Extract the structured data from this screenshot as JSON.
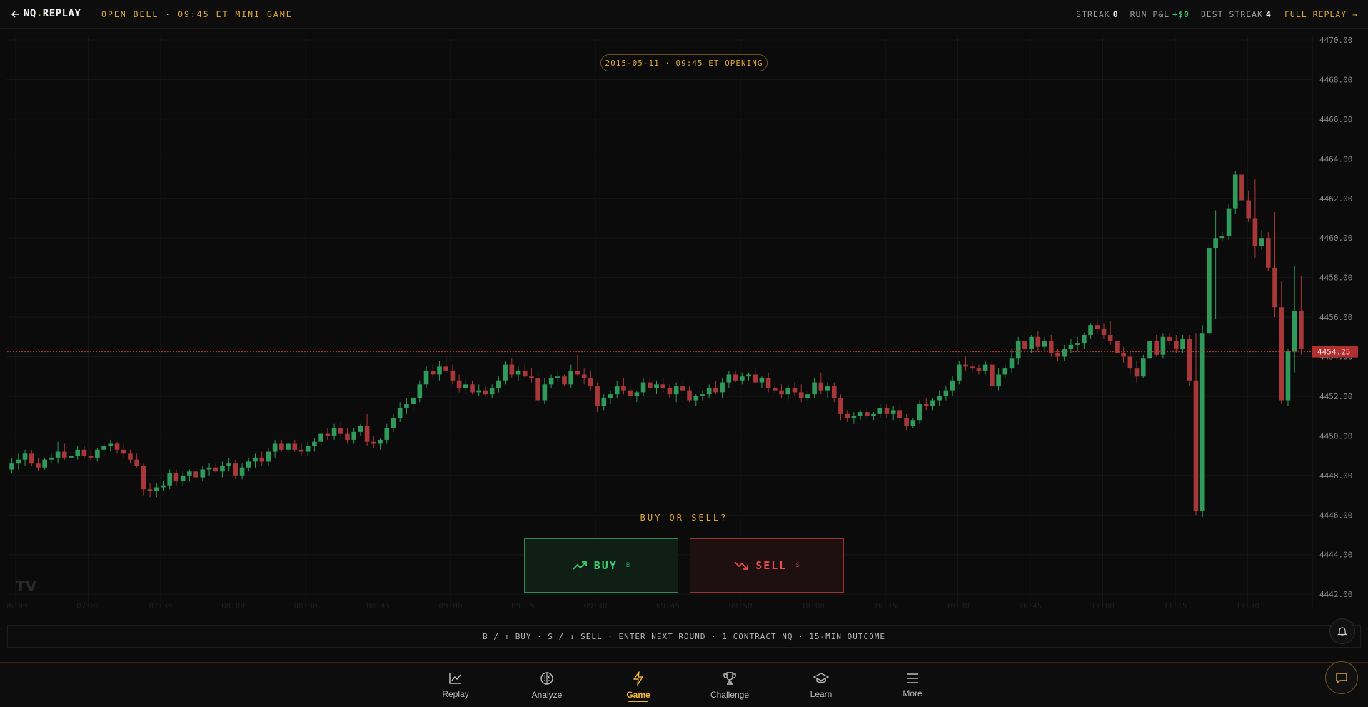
{
  "header": {
    "brand_left": "NQ",
    "brand_dot": ".",
    "brand_right": "REPLAY",
    "subtitle": "OPEN BELL · 09:45 ET MINI GAME",
    "streak_label": "STREAK",
    "streak_value": "0",
    "pnl_label": "RUN P&L",
    "pnl_value": "+$0",
    "best_label": "BEST STREAK",
    "best_value": "4",
    "full_replay": "FULL REPLAY →"
  },
  "session_pill": "2015-05-11 · 09:45 ET OPENING",
  "prompt": "BUY OR SELL?",
  "buy": {
    "label": "BUY",
    "key": "B"
  },
  "sell": {
    "label": "SELL",
    "key": "S"
  },
  "hint": "B / ↑ BUY · S / ↓ SELL · ENTER NEXT ROUND · 1 CONTRACT NQ · 15-MIN OUTCOME",
  "colors": {
    "accent": "#e0a53c",
    "up": "#2f9a5a",
    "down": "#a83838",
    "price_line": "#c0392b"
  },
  "chart_data": {
    "type": "candlestick",
    "y_ticks": [
      "4470.00",
      "4468.00",
      "4466.00",
      "4464.00",
      "4462.00",
      "4460.00",
      "4458.00",
      "4456.00",
      "4454.00",
      "4452.00",
      "4450.00",
      "4448.00",
      "4446.00",
      "4444.00",
      "4442.00"
    ],
    "ylim": [
      4441.5,
      4470.0
    ],
    "last_price": "4454.25",
    "x_ticks": [
      "06:00",
      "07:00",
      "07:30",
      "08:00",
      "08:30",
      "08:45",
      "09:00",
      "09:15",
      "09:30",
      "09:45",
      "09:50",
      "10:00",
      "10:15",
      "10:30",
      "10:45",
      "11:00",
      "11:15",
      "11:30"
    ],
    "ohlc": [
      [
        4448.3,
        4448.9,
        4448.1,
        4448.6
      ],
      [
        4448.6,
        4449.1,
        4448.3,
        4448.8
      ],
      [
        4448.8,
        4449.3,
        4448.5,
        4449.1
      ],
      [
        4449.1,
        4449.3,
        4448.5,
        4448.6
      ],
      [
        4448.6,
        4448.9,
        4448.2,
        4448.4
      ],
      [
        4448.4,
        4448.9,
        4448.3,
        4448.8
      ],
      [
        4448.8,
        4449.1,
        4448.6,
        4448.9
      ],
      [
        4448.9,
        4449.7,
        4448.6,
        4449.2
      ],
      [
        4449.2,
        4449.6,
        4448.8,
        4448.9
      ],
      [
        4448.9,
        4449.2,
        4448.7,
        4449.0
      ],
      [
        4449.0,
        4449.5,
        4448.8,
        4449.3
      ],
      [
        4449.3,
        4449.5,
        4448.9,
        4449.0
      ],
      [
        4449.0,
        4449.3,
        4448.7,
        4448.9
      ],
      [
        4448.9,
        4449.4,
        4448.7,
        4449.3
      ],
      [
        4449.3,
        4449.7,
        4449.0,
        4449.5
      ],
      [
        4449.5,
        4449.8,
        4449.2,
        4449.6
      ],
      [
        4449.6,
        4449.7,
        4449.1,
        4449.3
      ],
      [
        4449.3,
        4449.6,
        4448.9,
        4449.1
      ],
      [
        4449.1,
        4449.3,
        4448.6,
        4448.8
      ],
      [
        4448.8,
        4449.1,
        4448.4,
        4448.5
      ],
      [
        4448.5,
        4448.6,
        4447.0,
        4447.3
      ],
      [
        4447.3,
        4447.6,
        4446.9,
        4447.2
      ],
      [
        4447.2,
        4447.6,
        4446.9,
        4447.4
      ],
      [
        4447.4,
        4447.7,
        4447.2,
        4447.5
      ],
      [
        4447.5,
        4448.3,
        4447.3,
        4448.1
      ],
      [
        4448.1,
        4448.3,
        4447.5,
        4447.7
      ],
      [
        4447.7,
        4448.2,
        4447.5,
        4448.0
      ],
      [
        4448.0,
        4448.3,
        4447.7,
        4448.2
      ],
      [
        4448.2,
        4448.4,
        4447.7,
        4447.9
      ],
      [
        4447.9,
        4448.5,
        4447.7,
        4448.3
      ],
      [
        4448.3,
        4448.6,
        4448.0,
        4448.4
      ],
      [
        4448.4,
        4448.6,
        4448.1,
        4448.2
      ],
      [
        4448.2,
        4448.7,
        4447.9,
        4448.5
      ],
      [
        4448.5,
        4448.9,
        4448.2,
        4448.6
      ],
      [
        4448.6,
        4448.8,
        4447.8,
        4448.0
      ],
      [
        4448.0,
        4448.6,
        4447.8,
        4448.4
      ],
      [
        4448.4,
        4448.9,
        4448.2,
        4448.7
      ],
      [
        4448.7,
        4449.1,
        4448.4,
        4448.9
      ],
      [
        4448.9,
        4449.2,
        4448.5,
        4448.7
      ],
      [
        4448.7,
        4449.4,
        4448.5,
        4449.2
      ],
      [
        4449.2,
        4449.8,
        4448.9,
        4449.6
      ],
      [
        4449.6,
        4449.8,
        4449.2,
        4449.3
      ],
      [
        4449.3,
        4449.7,
        4449.0,
        4449.6
      ],
      [
        4449.6,
        4449.8,
        4449.2,
        4449.3
      ],
      [
        4449.3,
        4449.6,
        4449.0,
        4449.2
      ],
      [
        4449.2,
        4449.7,
        4449.0,
        4449.5
      ],
      [
        4449.5,
        4449.9,
        4449.2,
        4449.7
      ],
      [
        4449.7,
        4450.3,
        4449.5,
        4450.1
      ],
      [
        4450.1,
        4450.4,
        4449.8,
        4450.0
      ],
      [
        4450.0,
        4450.6,
        4449.8,
        4450.4
      ],
      [
        4450.4,
        4450.7,
        4449.9,
        4450.1
      ],
      [
        4450.1,
        4450.4,
        4449.6,
        4449.8
      ],
      [
        4449.8,
        4450.4,
        4449.6,
        4450.2
      ],
      [
        4450.2,
        4450.6,
        4450.0,
        4450.5
      ],
      [
        4450.5,
        4451.1,
        4449.5,
        4449.7
      ],
      [
        4449.7,
        4450.0,
        4449.4,
        4449.6
      ],
      [
        4449.6,
        4449.9,
        4449.3,
        4449.8
      ],
      [
        4449.8,
        4450.6,
        4449.6,
        4450.4
      ],
      [
        4450.4,
        4451.1,
        4450.2,
        4450.9
      ],
      [
        4450.9,
        4451.7,
        4450.7,
        4451.4
      ],
      [
        4451.4,
        4451.9,
        4451.1,
        4451.6
      ],
      [
        4451.6,
        4452.0,
        4451.3,
        4451.9
      ],
      [
        4451.9,
        4452.8,
        4451.7,
        4452.6
      ],
      [
        4452.6,
        4453.5,
        4452.4,
        4453.3
      ],
      [
        4453.3,
        4453.6,
        4452.9,
        4453.1
      ],
      [
        4453.1,
        4453.8,
        4452.8,
        4453.5
      ],
      [
        4453.5,
        4454.0,
        4453.2,
        4453.3
      ],
      [
        4453.3,
        4453.6,
        4452.6,
        4452.8
      ],
      [
        4452.8,
        4453.1,
        4452.2,
        4452.4
      ],
      [
        4452.4,
        4452.9,
        4452.1,
        4452.6
      ],
      [
        4452.6,
        4452.8,
        4452.1,
        4452.2
      ],
      [
        4452.2,
        4452.6,
        4452.0,
        4452.3
      ],
      [
        4452.3,
        4452.5,
        4452.0,
        4452.1
      ],
      [
        4452.1,
        4452.6,
        4451.9,
        4452.4
      ],
      [
        4452.4,
        4453.0,
        4452.2,
        4452.8
      ],
      [
        4452.8,
        4453.8,
        4452.6,
        4453.6
      ],
      [
        4453.6,
        4453.9,
        4452.9,
        4453.1
      ],
      [
        4453.1,
        4453.5,
        4452.8,
        4453.3
      ],
      [
        4453.3,
        4453.6,
        4452.9,
        4453.0
      ],
      [
        4453.0,
        4453.4,
        4452.7,
        4452.9
      ],
      [
        4452.9,
        4453.2,
        4451.6,
        4451.8
      ],
      [
        4451.8,
        4452.9,
        4451.6,
        4452.6
      ],
      [
        4452.6,
        4453.1,
        4452.4,
        4452.9
      ],
      [
        4452.9,
        4453.3,
        4452.7,
        4453.0
      ],
      [
        4453.0,
        4453.1,
        4452.5,
        4452.6
      ],
      [
        4452.6,
        4453.6,
        4452.4,
        4453.3
      ],
      [
        4453.3,
        4454.1,
        4453.0,
        4453.1
      ],
      [
        4453.1,
        4453.4,
        4452.6,
        4452.9
      ],
      [
        4452.9,
        4453.3,
        4452.3,
        4452.5
      ],
      [
        4452.5,
        4452.7,
        4451.2,
        4451.5
      ],
      [
        4451.5,
        4452.1,
        4451.3,
        4451.9
      ],
      [
        4451.9,
        4452.3,
        4451.6,
        4452.1
      ],
      [
        4452.1,
        4452.8,
        4451.9,
        4452.5
      ],
      [
        4452.5,
        4452.9,
        4452.1,
        4452.3
      ],
      [
        4452.3,
        4452.6,
        4451.8,
        4452.0
      ],
      [
        4452.0,
        4452.3,
        4451.7,
        4452.2
      ],
      [
        4452.2,
        4452.9,
        4452.0,
        4452.7
      ],
      [
        4452.7,
        4452.9,
        4452.3,
        4452.4
      ],
      [
        4452.4,
        4452.8,
        4452.1,
        4452.6
      ],
      [
        4452.6,
        4452.9,
        4452.2,
        4452.4
      ],
      [
        4452.4,
        4452.6,
        4451.9,
        4452.1
      ],
      [
        4452.1,
        4452.7,
        4451.7,
        4452.5
      ],
      [
        4452.5,
        4452.8,
        4452.2,
        4452.3
      ],
      [
        4452.3,
        4452.5,
        4451.7,
        4451.8
      ],
      [
        4451.8,
        4452.1,
        4451.5,
        4452.0
      ],
      [
        4452.0,
        4452.3,
        4451.8,
        4452.1
      ],
      [
        4452.1,
        4452.6,
        4451.9,
        4452.4
      ],
      [
        4452.4,
        4452.8,
        4452.1,
        4452.2
      ],
      [
        4452.2,
        4452.9,
        4451.9,
        4452.7
      ],
      [
        4452.7,
        4453.3,
        4452.4,
        4453.1
      ],
      [
        4453.1,
        4453.3,
        4452.7,
        4452.8
      ],
      [
        4452.8,
        4453.2,
        4452.6,
        4453.0
      ],
      [
        4453.0,
        4453.2,
        4452.8,
        4453.1
      ],
      [
        4453.1,
        4453.4,
        4452.6,
        4452.7
      ],
      [
        4452.7,
        4453.0,
        4452.4,
        4452.9
      ],
      [
        4452.9,
        4453.2,
        4452.2,
        4452.4
      ],
      [
        4452.4,
        4452.8,
        4452.1,
        4452.3
      ],
      [
        4452.3,
        4452.6,
        4451.9,
        4452.1
      ],
      [
        4452.1,
        4452.6,
        4451.8,
        4452.4
      ],
      [
        4452.4,
        4452.7,
        4452.0,
        4452.2
      ],
      [
        4452.2,
        4452.6,
        4451.7,
        4451.9
      ],
      [
        4451.9,
        4452.3,
        4451.6,
        4452.1
      ],
      [
        4452.1,
        4452.9,
        4451.9,
        4452.7
      ],
      [
        4452.7,
        4453.2,
        4452.1,
        4452.3
      ],
      [
        4452.3,
        4452.7,
        4451.9,
        4452.5
      ],
      [
        4452.5,
        4452.7,
        4451.7,
        4451.9
      ],
      [
        4451.9,
        4452.1,
        4450.8,
        4451.1
      ],
      [
        4451.1,
        4451.3,
        4450.7,
        4450.9
      ],
      [
        4450.9,
        4451.2,
        4450.6,
        4451.0
      ],
      [
        4451.0,
        4451.3,
        4450.8,
        4451.2
      ],
      [
        4451.2,
        4451.4,
        4450.9,
        4451.0
      ],
      [
        4451.0,
        4451.2,
        4450.8,
        4451.1
      ],
      [
        4451.1,
        4451.6,
        4450.9,
        4451.4
      ],
      [
        4451.4,
        4451.6,
        4450.9,
        4451.1
      ],
      [
        4451.1,
        4451.5,
        4450.8,
        4451.3
      ],
      [
        4451.3,
        4451.7,
        4450.7,
        4450.9
      ],
      [
        4450.9,
        4451.1,
        4450.3,
        4450.5
      ],
      [
        4450.5,
        4450.9,
        4450.4,
        4450.8
      ],
      [
        4450.8,
        4451.8,
        4450.6,
        4451.6
      ],
      [
        4451.6,
        4451.9,
        4451.3,
        4451.5
      ],
      [
        4451.5,
        4451.9,
        4451.3,
        4451.8
      ],
      [
        4451.8,
        4452.3,
        4451.5,
        4452.0
      ],
      [
        4452.0,
        4452.5,
        4451.8,
        4452.3
      ],
      [
        4452.3,
        4453.0,
        4452.0,
        4452.8
      ],
      [
        4452.8,
        4453.8,
        4452.6,
        4453.6
      ],
      [
        4453.6,
        4454.0,
        4453.3,
        4453.5
      ],
      [
        4453.5,
        4453.8,
        4453.2,
        4453.4
      ],
      [
        4453.4,
        4453.6,
        4453.1,
        4453.3
      ],
      [
        4453.3,
        4453.8,
        4453.1,
        4453.6
      ],
      [
        4453.6,
        4453.8,
        4452.3,
        4452.5
      ],
      [
        4452.5,
        4453.4,
        4452.3,
        4453.1
      ],
      [
        4453.1,
        4453.6,
        4452.9,
        4453.4
      ],
      [
        4453.4,
        4454.4,
        4453.2,
        4453.9
      ],
      [
        4453.9,
        4455.0,
        4453.6,
        4454.8
      ],
      [
        4454.8,
        4455.3,
        4454.2,
        4454.4
      ],
      [
        4454.4,
        4455.1,
        4454.2,
        4455.0
      ],
      [
        4455.0,
        4455.3,
        4454.3,
        4454.5
      ],
      [
        4454.5,
        4455.0,
        4454.3,
        4454.8
      ],
      [
        4454.8,
        4455.1,
        4454.0,
        4454.2
      ],
      [
        4454.2,
        4454.4,
        4453.8,
        4454.0
      ],
      [
        4454.0,
        4454.6,
        4453.8,
        4454.4
      ],
      [
        4454.4,
        4454.9,
        4454.2,
        4454.6
      ],
      [
        4454.6,
        4455.0,
        4454.3,
        4454.7
      ],
      [
        4454.7,
        4455.2,
        4454.4,
        4455.1
      ],
      [
        4455.1,
        4455.7,
        4454.9,
        4455.6
      ],
      [
        4455.6,
        4455.9,
        4455.2,
        4455.4
      ],
      [
        4455.4,
        4455.7,
        4454.9,
        4455.1
      ],
      [
        4455.1,
        4455.8,
        4454.6,
        4454.8
      ],
      [
        4454.8,
        4455.0,
        4454.0,
        4454.2
      ],
      [
        4454.2,
        4454.5,
        4453.7,
        4454.0
      ],
      [
        4454.0,
        4454.3,
        4453.1,
        4453.4
      ],
      [
        4453.4,
        4453.8,
        4452.7,
        4453.0
      ],
      [
        4453.0,
        4454.1,
        4452.9,
        4453.9
      ],
      [
        4453.9,
        4454.9,
        4453.7,
        4454.8
      ],
      [
        4454.8,
        4455.1,
        4454.0,
        4454.1
      ],
      [
        4454.1,
        4455.2,
        4453.9,
        4455.0
      ],
      [
        4455.0,
        4455.2,
        4454.6,
        4454.8
      ],
      [
        4454.8,
        4455.1,
        4454.2,
        4454.4
      ],
      [
        4454.4,
        4455.1,
        4454.2,
        4454.9
      ],
      [
        4454.9,
        4455.1,
        4452.5,
        4452.8
      ],
      [
        4452.8,
        4455.2,
        4446.0,
        4446.2
      ],
      [
        4446.2,
        4455.6,
        4445.9,
        4455.2
      ],
      [
        4455.2,
        4459.8,
        4455.0,
        4459.5
      ],
      [
        4459.5,
        4461.4,
        4455.9,
        4460.0
      ],
      [
        4460.0,
        4460.3,
        4459.8,
        4460.1
      ],
      [
        4460.1,
        4461.7,
        4459.9,
        4461.5
      ],
      [
        4461.5,
        4463.4,
        4461.2,
        4463.2
      ],
      [
        4463.2,
        4464.5,
        4461.5,
        4461.9
      ],
      [
        4461.9,
        4462.4,
        4460.8,
        4461.0
      ],
      [
        4461.0,
        4463.0,
        4459.0,
        4459.6
      ],
      [
        4459.6,
        4460.4,
        4459.4,
        4460.0
      ],
      [
        4460.0,
        4460.3,
        4458.3,
        4458.5
      ],
      [
        4458.5,
        4461.3,
        4456.0,
        4456.5
      ],
      [
        4456.5,
        4457.8,
        4451.6,
        4451.8
      ],
      [
        4451.8,
        4454.4,
        4451.5,
        4454.3
      ],
      [
        4454.3,
        4458.6,
        4453.2,
        4456.3
      ],
      [
        4456.3,
        4458.1,
        4454.1,
        4454.4
      ]
    ]
  },
  "nav": [
    {
      "label": "Replay",
      "icon": "line-chart-icon"
    },
    {
      "label": "Analyze",
      "icon": "brain-icon"
    },
    {
      "label": "Game",
      "icon": "lightning-icon",
      "active": true
    },
    {
      "label": "Challenge",
      "icon": "trophy-icon"
    },
    {
      "label": "Learn",
      "icon": "graduation-cap-icon"
    },
    {
      "label": "More",
      "icon": "menu-icon"
    }
  ]
}
